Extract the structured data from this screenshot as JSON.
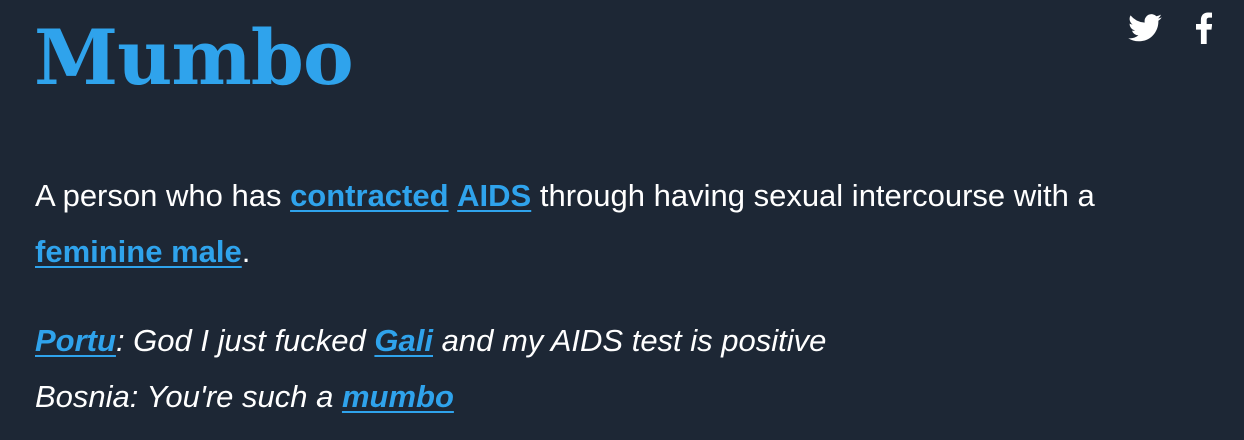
{
  "definition": {
    "word": "Mumbo",
    "meaning": {
      "text_1": "A person who has ",
      "link_1": "contracted",
      "text_2": " ",
      "link_2": "AIDS",
      "text_3": " through having sexual intercourse with a ",
      "link_3": "feminine male",
      "text_4": "."
    },
    "example": {
      "line_1": {
        "link_1": "Portu",
        "text_1": ": God I just fucked ",
        "link_2": "Gali",
        "text_2": " and my AIDS test is positive"
      },
      "line_2": {
        "text_1": "Bosnia: You're such a ",
        "link_1": "mumbo"
      }
    }
  },
  "share": {
    "icons": [
      "twitter-icon",
      "facebook-icon"
    ]
  },
  "colors": {
    "background": "#1d2735",
    "accent": "#2fa3ec",
    "text": "#ffffff"
  }
}
